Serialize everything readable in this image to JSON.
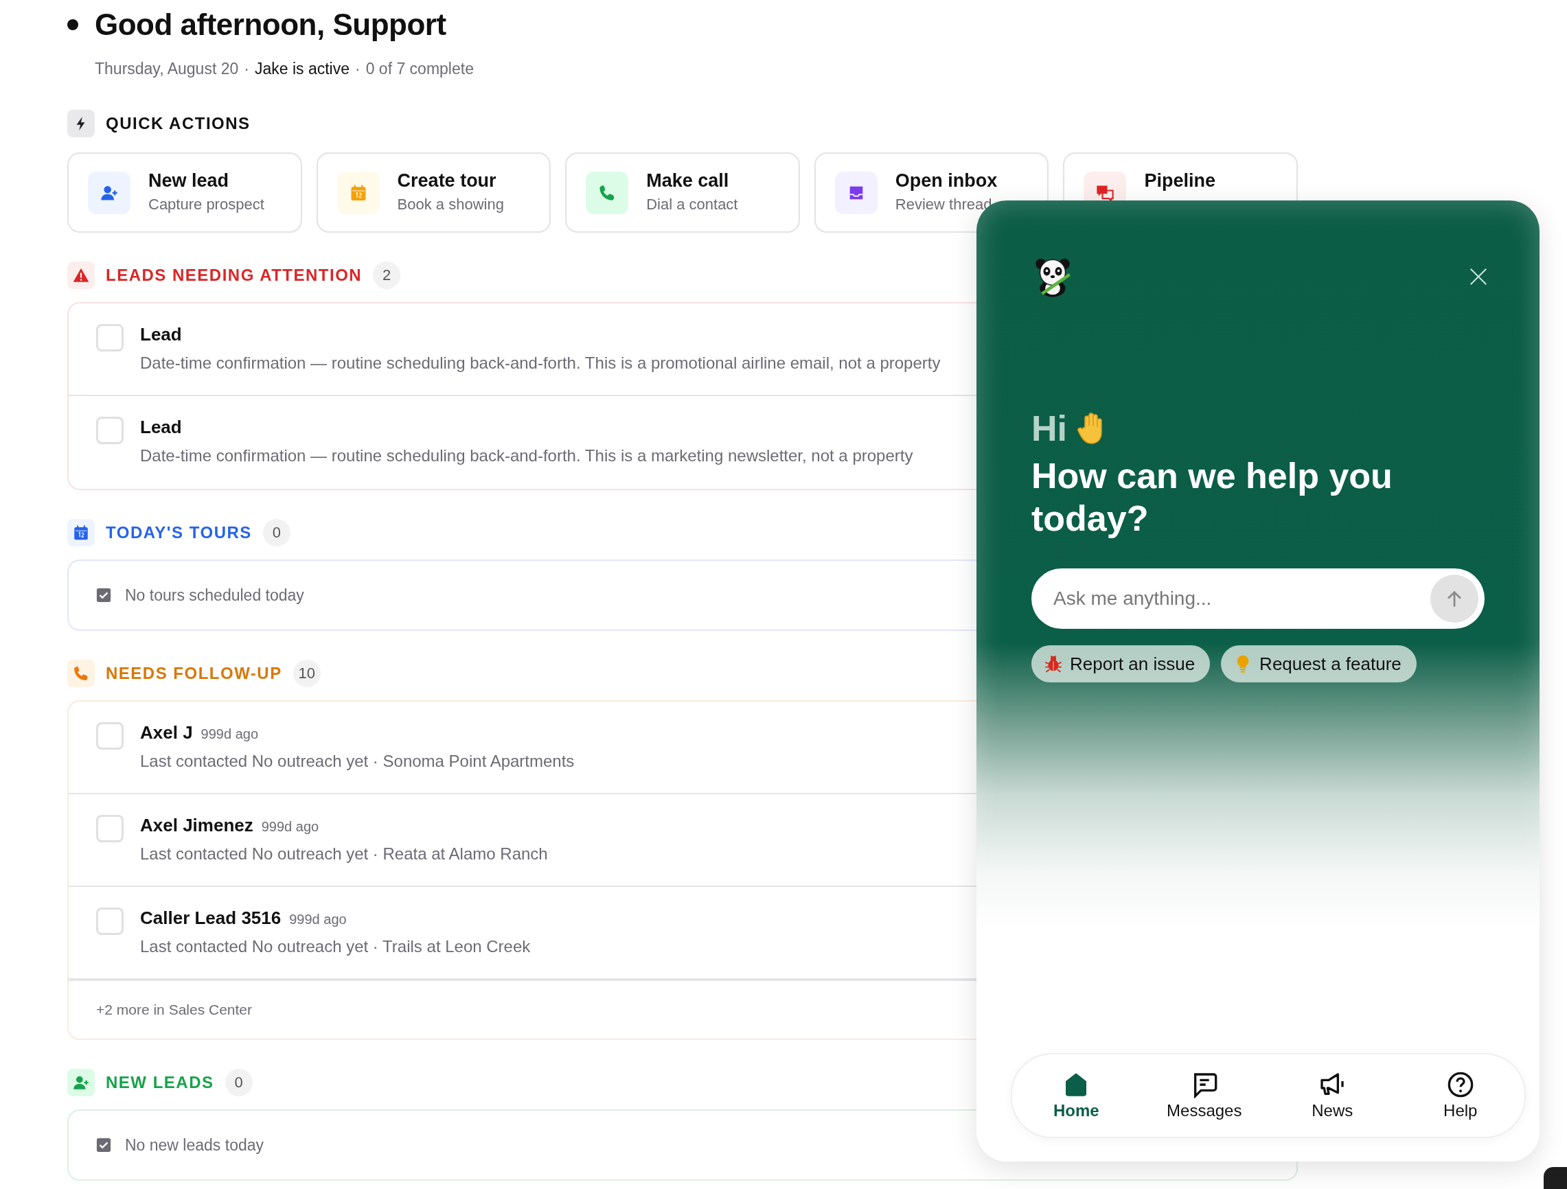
{
  "greeting": {
    "title": "Good afternoon, Support",
    "subline": [
      {
        "kind": "muted",
        "text": "Thursday, August 20"
      },
      {
        "kind": "muted",
        "text": "·"
      },
      {
        "kind": "strong",
        "text": "Jake is active"
      },
      {
        "kind": "muted",
        "text": "·"
      },
      {
        "kind": "muted",
        "text": "0 of 7 complete"
      }
    ]
  },
  "quick_actions": {
    "title": "QUICK ACTIONS",
    "items": [
      {
        "kind": "new-lead",
        "label": "New lead",
        "subtitle": "Capture prospect"
      },
      {
        "kind": "tour",
        "label": "Create tour",
        "subtitle": "Book a showing"
      },
      {
        "kind": "call",
        "label": "Make call",
        "subtitle": "Dial a contact"
      },
      {
        "kind": "inbox",
        "label": "Open inbox",
        "subtitle": "Review thread"
      },
      {
        "kind": "pipeline",
        "label": "Pipeline"
      }
    ]
  },
  "sections": [
    {
      "kind": "attention",
      "title": "LEADS NEEDING ATTENTION",
      "count": "2",
      "rows": [
        {
          "title": "Lead",
          "description": "Date-time confirmation — routine scheduling back-and-forth. This is a promotional airline email, not a property",
          "checked": false
        },
        {
          "title": "Lead",
          "description": "Date-time confirmation — routine scheduling back-and-forth. This is a marketing newsletter, not a property",
          "checked": false
        }
      ]
    },
    {
      "kind": "tours",
      "title": "TODAY'S TOURS",
      "count": "0",
      "empty": "No tours scheduled today"
    },
    {
      "kind": "follow-up",
      "title": "NEEDS FOLLOW-UP",
      "count": "10",
      "rows": [
        {
          "title": "Axel J",
          "age": "999d ago",
          "description": "Last contacted No outreach yet · Sonoma Point Apartments",
          "checked": false
        },
        {
          "title": "Axel Jimenez",
          "age": "999d ago",
          "description": "Last contacted No outreach yet · Reata at Alamo Ranch",
          "checked": false
        },
        {
          "title": "Caller Lead 3516",
          "age": "999d ago",
          "description": "Last contacted No outreach yet · Trails at Leon Creek",
          "checked": false
        }
      ],
      "more": "+2 more in Sales Center"
    },
    {
      "kind": "new-leads",
      "title": "NEW LEADS",
      "count": "0",
      "empty": "No new leads today"
    }
  ],
  "widget": {
    "greeting": "Hi",
    "heading": "How can we help you today?",
    "search": {
      "placeholder": "Ask me anything..."
    },
    "chips": [
      {
        "kind": "bug",
        "label": "Report an issue"
      },
      {
        "kind": "bulb",
        "label": "Request a feature"
      }
    ],
    "nav": [
      {
        "kind": "home",
        "label": "Home",
        "selected": true
      },
      {
        "kind": "messages",
        "label": "Messages",
        "selected": false
      },
      {
        "kind": "news",
        "label": "News",
        "selected": false
      },
      {
        "kind": "help",
        "label": "Help",
        "selected": false
      }
    ]
  }
}
